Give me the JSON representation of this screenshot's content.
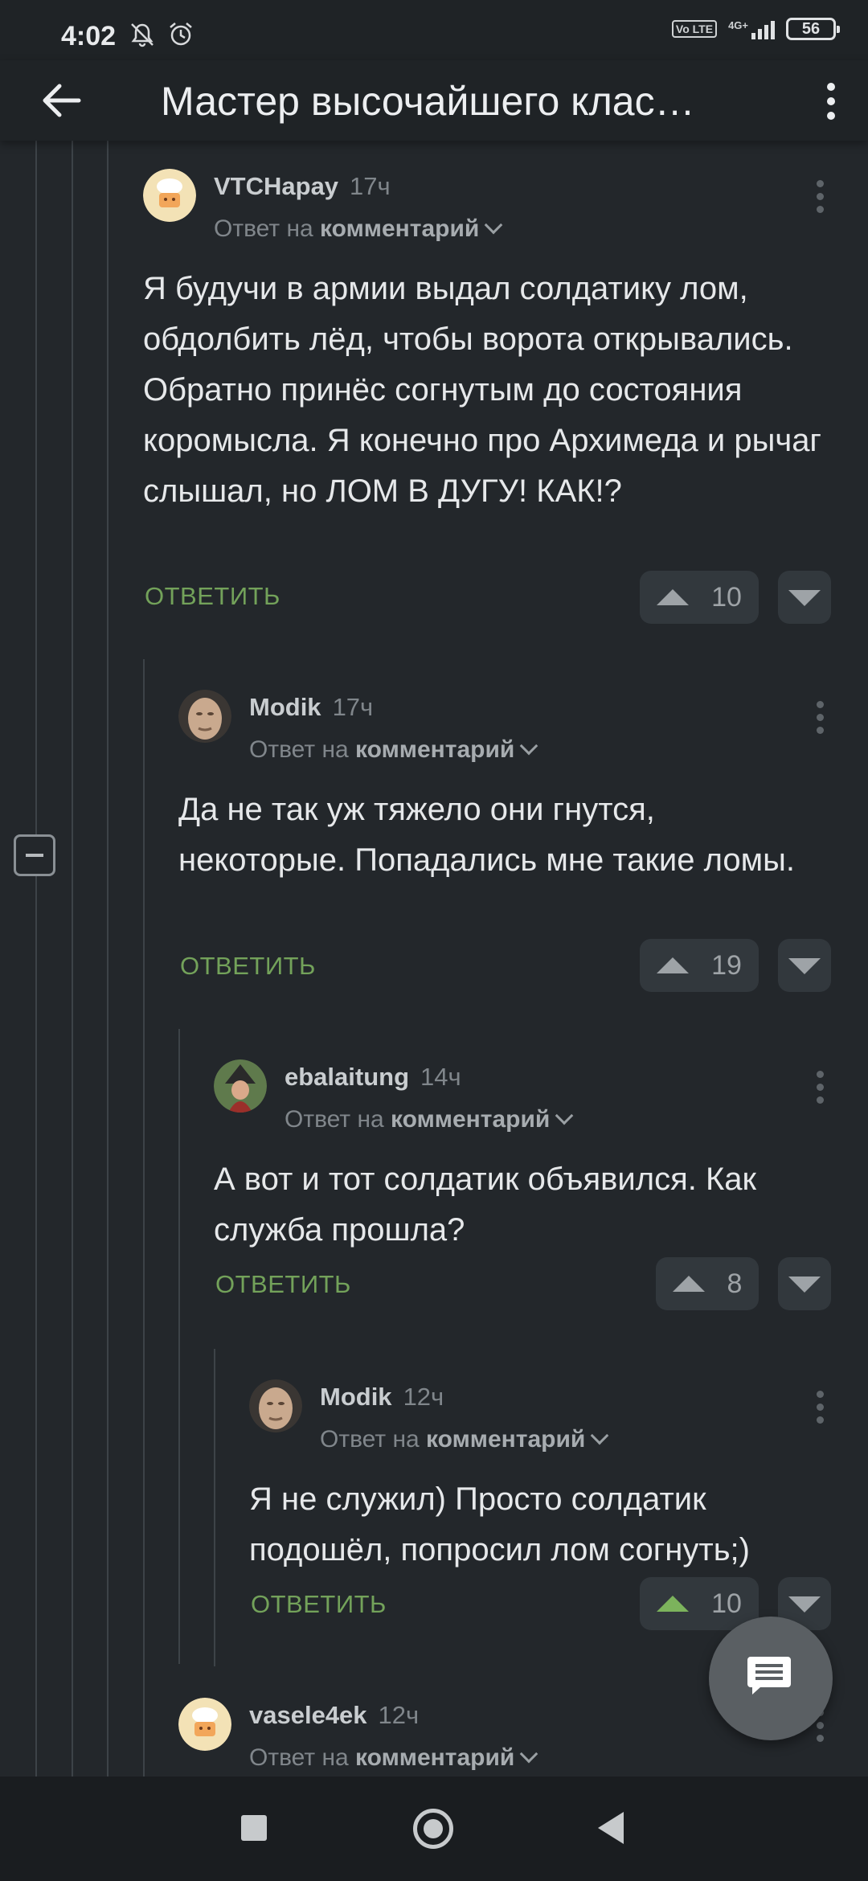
{
  "status_bar": {
    "time": "4:02",
    "volte_label": "Vo LTE",
    "network_label": "4G+",
    "battery": "56"
  },
  "app_bar": {
    "title": "Мастер высочайшего клас…",
    "back_icon": "arrow-left-icon",
    "menu_icon": "more-vert-icon"
  },
  "comments": [
    {
      "author": "VTCHapay",
      "time": "17ч",
      "reply_prefix": "Ответ на",
      "reply_target": "комментарий",
      "text": "Я будучи в армии выдал солдатику лом, обдолбить лёд, чтобы ворота открывались. Обратно принёс согнутым до состояния коромысла. Я конечно про Архимеда и рычаг слышал, но ЛОМ В ДУГУ! КАК!?",
      "reply_label": "ОТВЕТИТЬ",
      "rating": "10",
      "upvoted": false
    },
    {
      "author": "Modik",
      "time": "17ч",
      "reply_prefix": "Ответ на",
      "reply_target": "комментарий",
      "text": "Да не так уж тяжело они гнутся, некоторые. Попадались мне такие ломы.",
      "reply_label": "ОТВЕТИТЬ",
      "rating": "19",
      "upvoted": false
    },
    {
      "author": "ebalaitung",
      "time": "14ч",
      "reply_prefix": "Ответ на",
      "reply_target": "комментарий",
      "text": "А вот и тот солдатик объявился. Как служба прошла?",
      "reply_label": "ОТВЕТИТЬ",
      "rating": "8",
      "upvoted": false
    },
    {
      "author": "Modik",
      "time": "12ч",
      "reply_prefix": "Ответ на",
      "reply_target": "комментарий",
      "text": "Я не служил) Просто солдатик подошёл, попросил лом согнуть;)",
      "reply_label": "ОТВЕТИТЬ",
      "rating": "10",
      "upvoted": true
    },
    {
      "author": "vasele4ek",
      "time": "12ч",
      "reply_prefix": "Ответ на",
      "reply_target": "комментарий"
    }
  ],
  "colors": {
    "background": "#23272b",
    "accent_green": "#73a25a",
    "upvote_active": "#7cb35c"
  }
}
